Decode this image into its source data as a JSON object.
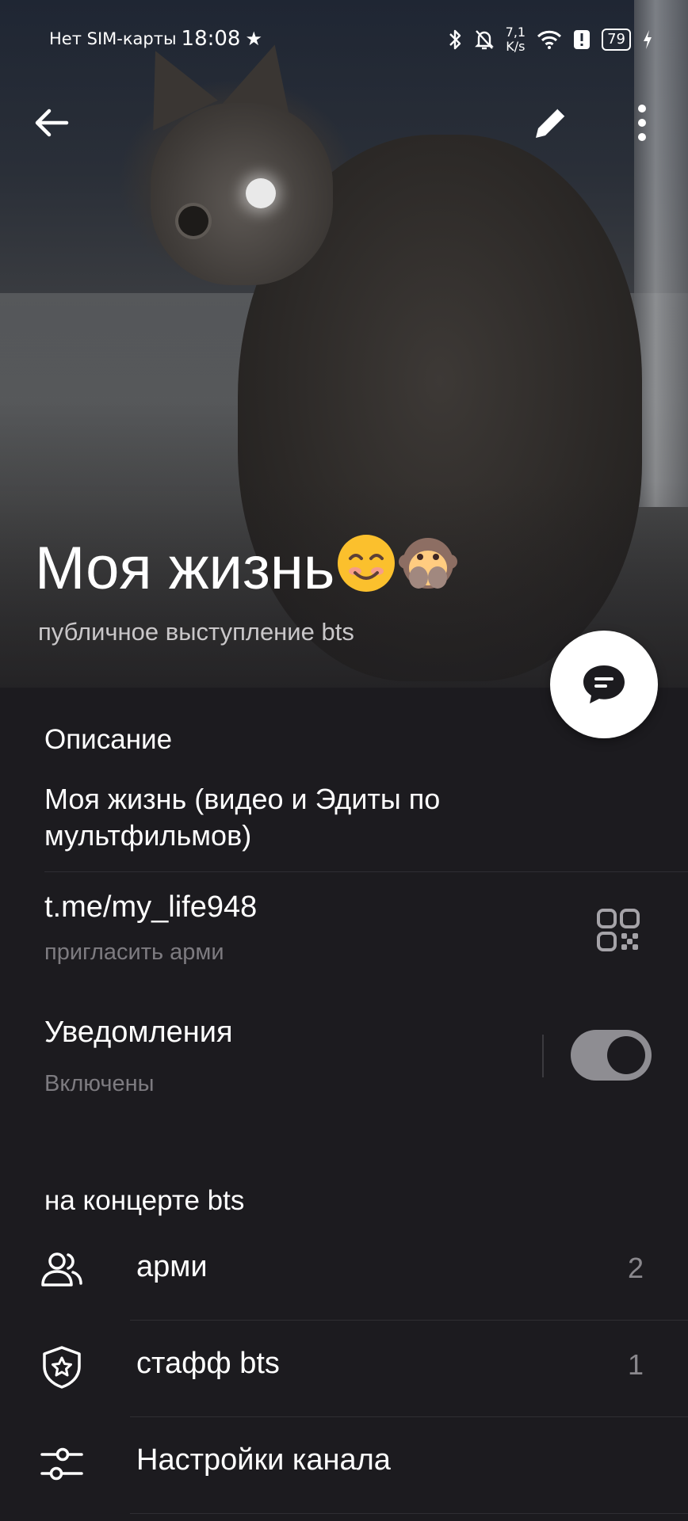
{
  "status_bar": {
    "carrier": "Нет SIM-карты",
    "time": "18:08",
    "speed_value": "7,1",
    "speed_unit": "K/s",
    "battery": "79"
  },
  "header": {
    "title": "Моя жизнь",
    "title_emojis": [
      "smiling-face-icon",
      "see-no-evil-monkey-icon"
    ],
    "subtitle": "публичное выступление bts"
  },
  "description": {
    "heading": "Описание",
    "text": "Моя жизнь (видео и Эдиты по мультфильмов)"
  },
  "link": {
    "url": "t.me/my_life948",
    "hint": "пригласить арми"
  },
  "notifications": {
    "title": "Уведомления",
    "state": "Включены",
    "enabled": true
  },
  "members_section": {
    "heading": "на концерте bts",
    "items": [
      {
        "icon": "users-icon",
        "label": "арми",
        "count": "2"
      },
      {
        "icon": "shield-star-icon",
        "label": "стафф bts",
        "count": "1"
      },
      {
        "icon": "sliders-icon",
        "label": "Настройки канала",
        "count": ""
      }
    ]
  },
  "colors": {
    "background": "#1c1b1f",
    "text_primary": "#ffffff",
    "text_secondary": "#7d7b80",
    "fab": "#ffffff",
    "toggle_track": "#8e8d92"
  }
}
